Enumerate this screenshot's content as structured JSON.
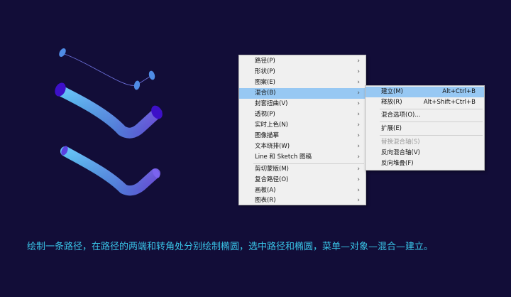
{
  "menu": {
    "items": [
      {
        "label": "路径(P)",
        "arrow": "›"
      },
      {
        "label": "形状(P)",
        "arrow": "›"
      },
      {
        "label": "图案(E)",
        "arrow": "›"
      },
      {
        "label": "混合(B)",
        "arrow": "›"
      },
      {
        "label": "封套扭曲(V)",
        "arrow": "›"
      },
      {
        "label": "透视(P)",
        "arrow": "›"
      },
      {
        "label": "实时上色(N)",
        "arrow": "›"
      },
      {
        "label": "图像描摹",
        "arrow": "›"
      },
      {
        "label": "文本绕排(W)",
        "arrow": "›"
      },
      {
        "label": "Line 和 Sketch 图稿",
        "arrow": "›"
      },
      {
        "label": "剪切蒙版(M)",
        "arrow": "›"
      },
      {
        "label": "复合路径(O)",
        "arrow": "›"
      },
      {
        "label": "画板(A)",
        "arrow": "›"
      },
      {
        "label": "图表(R)",
        "arrow": "›"
      }
    ]
  },
  "submenu": {
    "items": [
      {
        "label": "建立(M)",
        "shortcut": "Alt+Ctrl+B"
      },
      {
        "label": "释放(R)",
        "shortcut": "Alt+Shift+Ctrl+B"
      },
      {
        "label": "混合选项(O)..."
      },
      {
        "label": "扩展(E)"
      },
      {
        "label": "替换混合轴(S)"
      },
      {
        "label": "反向混合轴(V)"
      },
      {
        "label": "反向堆叠(F)"
      }
    ]
  },
  "caption": "绘制一条路径，在路径的两端和转角处分别绘制椭圆，选中路径和椭圆，菜单—对象—混合—建立。",
  "colors": {
    "background": "#120d38",
    "caption": "#39c3e6",
    "highlight": "#97c8f3",
    "tube_start": "#3fb6f2",
    "tube_end": "#6a55f0",
    "cap": "#3d10c8"
  }
}
